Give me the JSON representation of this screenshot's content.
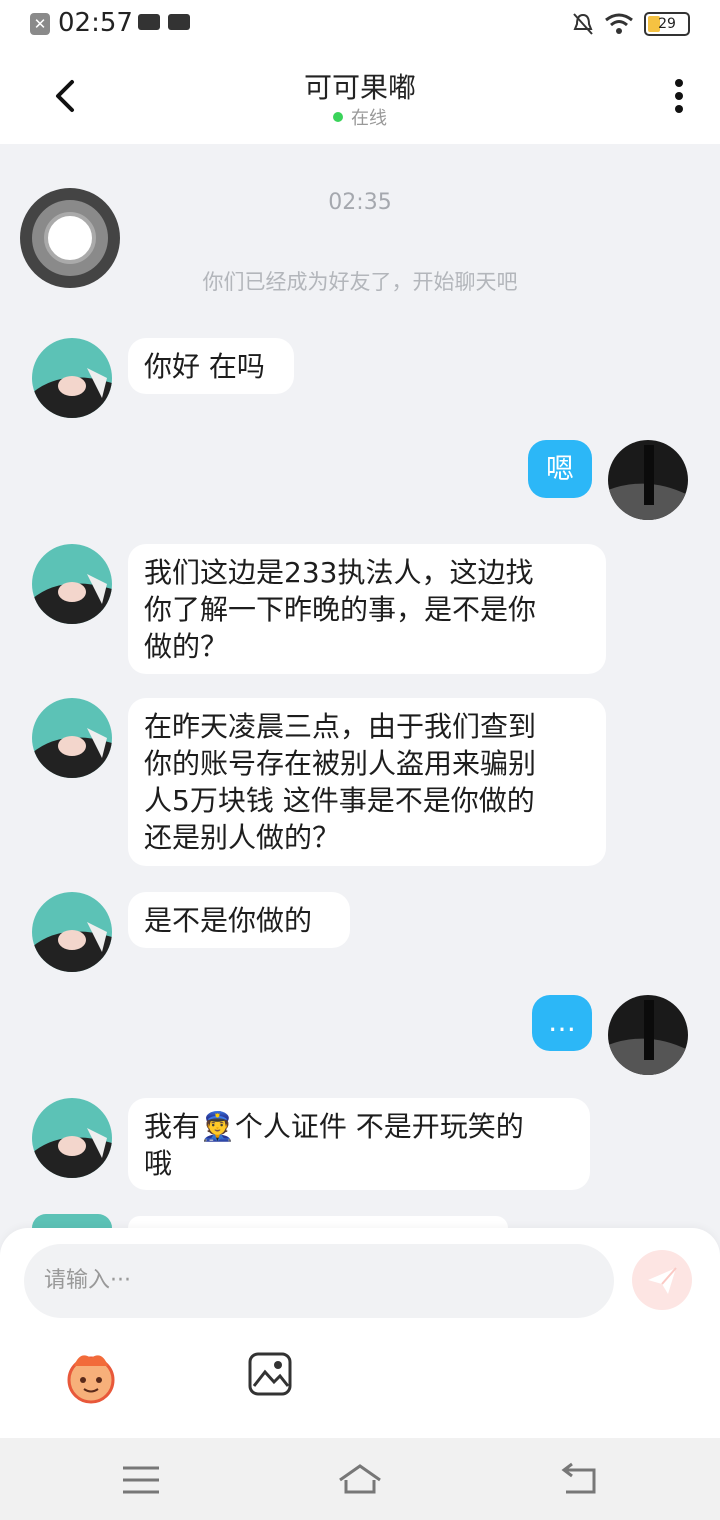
{
  "status_bar": {
    "time": "02:57",
    "battery": "29"
  },
  "header": {
    "title": "可可果嘟",
    "online": "在线"
  },
  "chat": {
    "timestamp": "02:35",
    "friend_note": "你们已经成为好友了，开始聊天吧",
    "messages": [
      {
        "side": "left",
        "text": "你好 在吗"
      },
      {
        "side": "right",
        "text": "嗯"
      },
      {
        "side": "left",
        "lines": [
          "我们这边是233执法人，这边找",
          "你了解一下昨晚的事，是不是你",
          "做的？"
        ]
      },
      {
        "side": "left",
        "lines": [
          "在昨天凌晨三点，由于我们查到",
          "你的账号存在被别人盗用来骗别",
          "人5万块钱 这件事是不是你做的",
          "还是别人做的？"
        ]
      },
      {
        "side": "left",
        "text": "是不是你做的"
      },
      {
        "side": "right",
        "text": "…"
      },
      {
        "side": "left",
        "line1": "我有👮个人证件 不是开玩笑的",
        "line2": "哦"
      }
    ]
  },
  "input": {
    "placeholder": "请输入···"
  },
  "icons": {
    "back": "chevron-left-icon",
    "more": "more-vertical-icon",
    "send": "send-icon",
    "emoji": "emoji-face-icon",
    "image": "image-icon",
    "nav_menu": "menu-icon",
    "nav_home": "home-icon",
    "nav_back": "back-icon"
  },
  "colors": {
    "accent": "#2cb7f7",
    "online": "#3ad35a",
    "send_bg": "#fde5e3"
  }
}
